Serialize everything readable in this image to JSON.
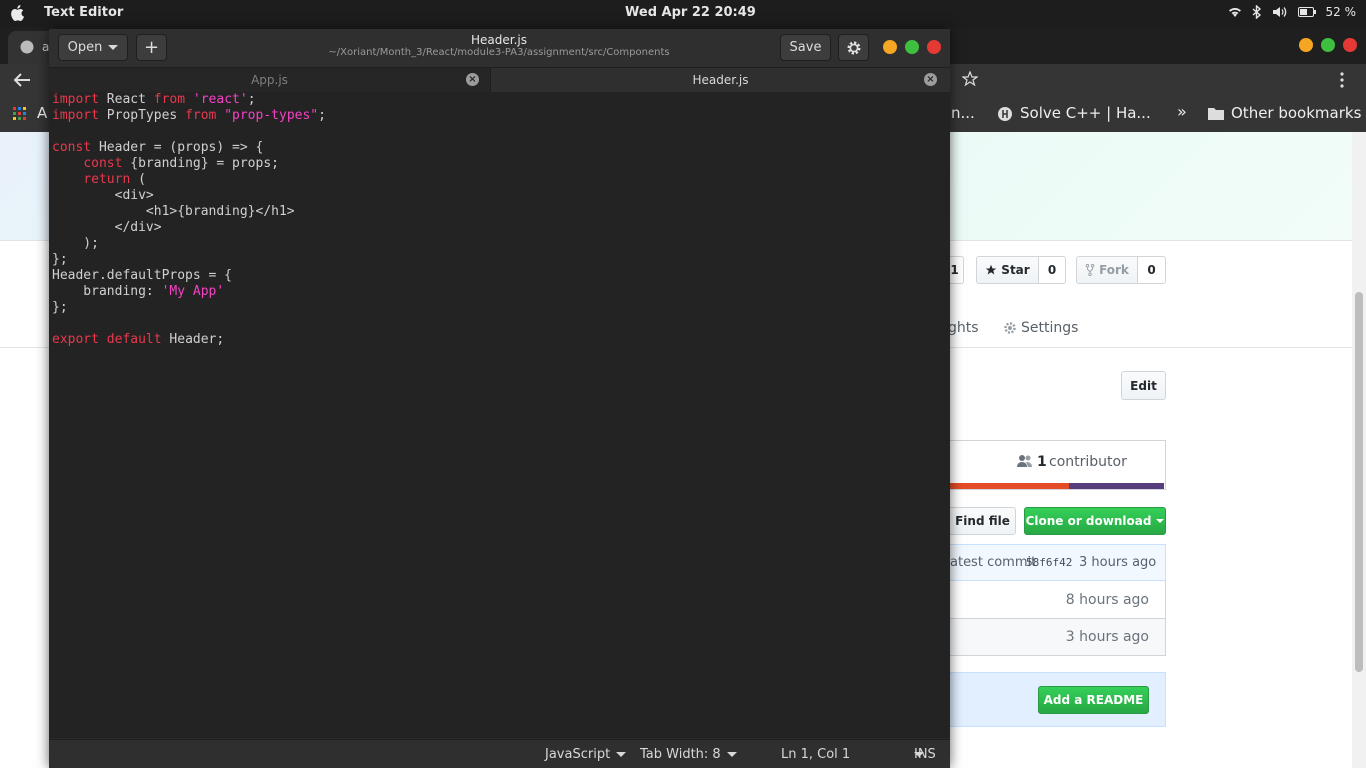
{
  "topbar": {
    "app_name": "Text Editor",
    "clock": "Wed Apr 22  20:49",
    "battery": "52 %"
  },
  "browser": {
    "tab_title": "a",
    "bookmarks": {
      "item1": "n...",
      "item2": "Solve C++ | Ha...",
      "more": "»",
      "other": "Other bookmarks",
      "left_initial": "A"
    }
  },
  "github": {
    "star_label": "Star",
    "star_count": "0",
    "fork_label": "Fork",
    "fork_count": "0",
    "left_count": "1",
    "insights_tab": "ghts",
    "settings_tab": "Settings",
    "edit_button": "Edit",
    "contributor_count": "1",
    "contributor_label": "contributor",
    "find_file": "Find file",
    "clone_download": "Clone or download",
    "latest_commit_label": "atest commit",
    "latest_commit_hash": "58f6f42",
    "latest_commit_time": "3 hours ago",
    "row1_time": "8 hours ago",
    "row2_time": "3 hours ago",
    "add_readme": "Add a README",
    "language_colors": [
      "#f1e05a",
      "#e34c26",
      "#563d7c"
    ]
  },
  "editor": {
    "open_label": "Open",
    "new_tab_label": "+",
    "title": "Header.js",
    "path": "~/Xoriant/Month_3/React/module3-PA3/assignment/src/Components",
    "save_label": "Save",
    "tabs": [
      {
        "label": "App.js",
        "active": false
      },
      {
        "label": "Header.js",
        "active": true
      }
    ],
    "code_lines": [
      "import React from 'react';",
      "import PropTypes from \"prop-types\";",
      "",
      "const Header = (props) => {",
      "    const {branding} = props;",
      "    return (",
      "        <div>",
      "            <h1>{branding}</h1>",
      "        </div>",
      "    );",
      "};",
      "Header.defaultProps = {",
      "    branding: 'My App'",
      "};",
      "",
      "export default Header;"
    ],
    "status": {
      "language": "JavaScript",
      "tab_width": "Tab Width: 8",
      "position": "Ln 1, Col 1",
      "mode": "INS"
    }
  }
}
